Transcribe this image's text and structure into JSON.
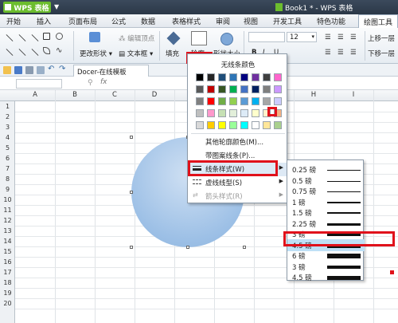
{
  "titlebar": {
    "app_label": "WPS 表格",
    "doc_title": "Book1 * - WPS 表格"
  },
  "menu": {
    "tabs": [
      "开始",
      "插入",
      "页面布局",
      "公式",
      "数据",
      "表格样式",
      "审阅",
      "视图",
      "开发工具",
      "特色功能",
      "绘图工具"
    ],
    "active": "绘图工具"
  },
  "ribbon": {
    "edit_points": "编辑顶点",
    "change_shape": "更改形状",
    "text_box": "文本框",
    "fill": "填充",
    "outline": "轮廓",
    "shape_size": "形状大小",
    "font_size": "12",
    "bring_forward": "上移一层",
    "send_backward": "下移一层"
  },
  "quickbar": {
    "doc_tab": "Docer-在线模板"
  },
  "formula_bar": {
    "fx": "fx"
  },
  "grid": {
    "columns": [
      "A",
      "B",
      "C",
      "D",
      "E",
      "F",
      "G",
      "H",
      "I"
    ],
    "rows": [
      "1",
      "2",
      "3",
      "4",
      "5",
      "6",
      "7",
      "8",
      "9",
      "10",
      "11",
      "12",
      "13",
      "14",
      "15",
      "16",
      "17",
      "18",
      "19",
      "20"
    ]
  },
  "color_menu": {
    "no_line": "无线条颜色",
    "more_colors": "其他轮廓颜色(M)...",
    "pattern_line": "带图案线条(P)...",
    "line_style": "线条样式(W)",
    "dash_type": "虚线线型(S)",
    "arrow_style": "箭头样式(R)",
    "palette": [
      [
        "#000000",
        "#262626",
        "#1f4e79",
        "#2e75b6",
        "#000080",
        "#7030a0",
        "#3f3f3f",
        "#ff66cc"
      ],
      [
        "#595959",
        "#c00000",
        "#375623",
        "#00b050",
        "#4472c4",
        "#002060",
        "#7f7f7f",
        "#cc99ff"
      ],
      [
        "#808080",
        "#ff0000",
        "#70ad47",
        "#92d050",
        "#5b9bd5",
        "#00b0f0",
        "#a6a6a6",
        "#ccccff"
      ],
      [
        "#bfbfbf",
        "#ff99cc",
        "#c6e0b4",
        "#e2efda",
        "#ddebf7",
        "#ffffcc",
        "#fff2cc",
        "#f4b183"
      ],
      [
        "#d9d9d9",
        "#ffcc00",
        "#ffff00",
        "#99ff99",
        "#00ffff",
        "#ffffff",
        "#ffe699",
        "#a9d08e"
      ]
    ]
  },
  "line_weights": [
    {
      "label": "0.25 磅",
      "weight": 1
    },
    {
      "label": "0.5 磅",
      "weight": 1
    },
    {
      "label": "0.75 磅",
      "weight": 1
    },
    {
      "label": "1 磅",
      "weight": 2
    },
    {
      "label": "1.5 磅",
      "weight": 2
    },
    {
      "label": "2.25 磅",
      "weight": 3
    },
    {
      "label": "3 磅",
      "weight": 4
    },
    {
      "label": "4.5 磅",
      "weight": 5
    },
    {
      "label": "6 磅",
      "weight": 6
    },
    {
      "label": "3 磅",
      "weight": 4
    },
    {
      "label": "4.5 磅",
      "weight": 5
    }
  ],
  "selected_weight_index": 7,
  "colors": {
    "accent_red": "#e0111b",
    "app_green": "#6cbd2e",
    "selection_blue": "#bfe0f6"
  }
}
